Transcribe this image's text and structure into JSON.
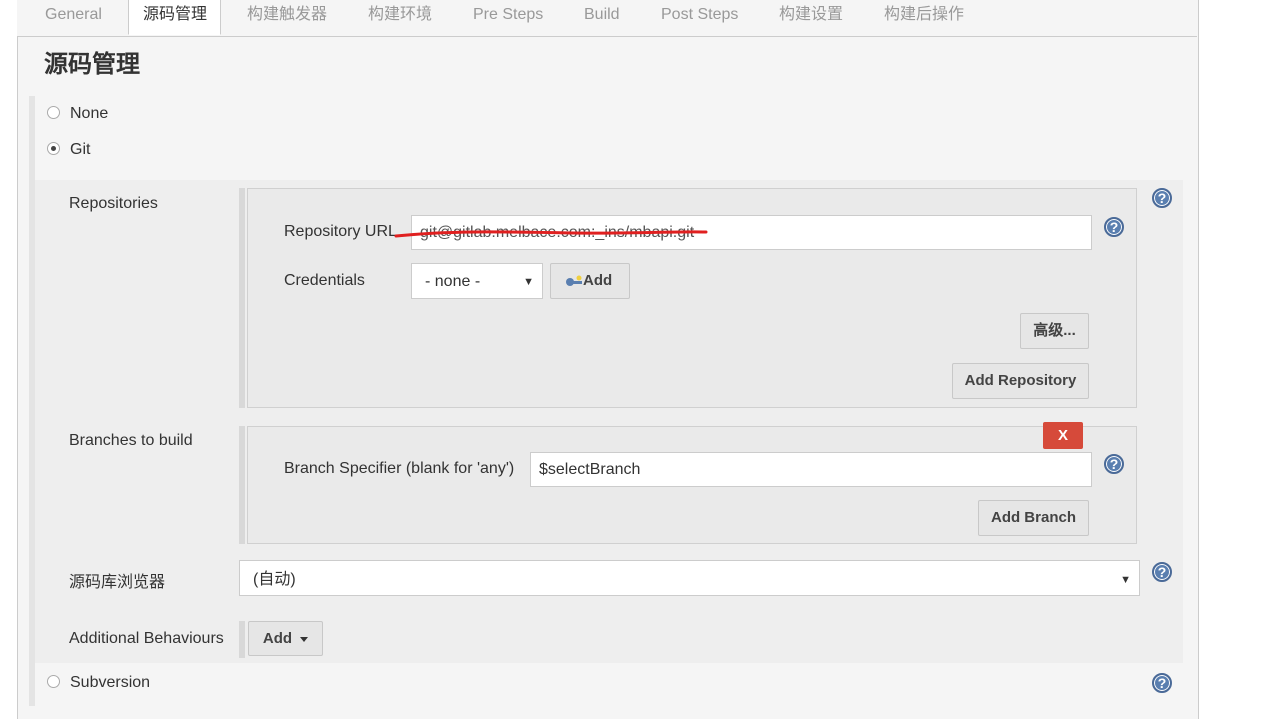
{
  "tabs": [
    "General",
    "源码管理",
    "构建触发器",
    "构建环境",
    "Pre Steps",
    "Build",
    "Post Steps",
    "构建设置",
    "构建后操作"
  ],
  "section_title": "源码管理",
  "scm_options": {
    "none": "None",
    "git": "Git",
    "subversion": "Subversion"
  },
  "git": {
    "repositories_label": "Repositories",
    "repository_url_label": "Repository URL",
    "repository_url_value": "git@gitlab.melbace.com:_ins/mbapi.git",
    "credentials_label": "Credentials",
    "credentials_value": "- none -",
    "add_credentials_label": "Add",
    "advanced_label": "高级...",
    "add_repository_label": "Add Repository",
    "branches_label": "Branches to build",
    "delete_branch_label": "X",
    "branch_specifier_label": "Branch Specifier (blank for 'any')",
    "branch_specifier_value": "$selectBranch",
    "add_branch_label": "Add Branch",
    "browser_label": "源码库浏览器",
    "browser_value": "(自动)",
    "additional_behaviours_label": "Additional Behaviours",
    "add_behaviour_label": "Add"
  },
  "help_symbol": "?",
  "colors": {
    "accent_help": "#5a7fb0",
    "delete_red": "#d64a3a",
    "strike_red": "#e02020"
  }
}
